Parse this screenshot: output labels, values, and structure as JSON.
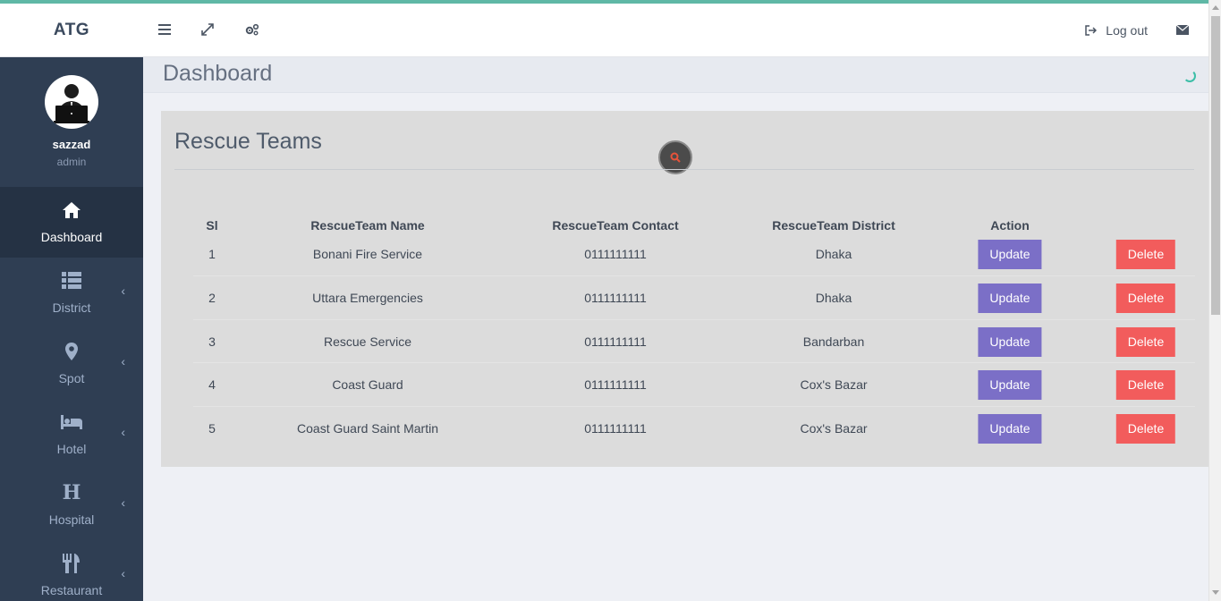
{
  "brand": "ATG",
  "topbar": {
    "logout_label": "Log out"
  },
  "user": {
    "name": "sazzad",
    "role": "admin"
  },
  "sidebar": {
    "items": [
      {
        "label": "Dashboard",
        "icon": "home-icon",
        "active": true
      },
      {
        "label": "District",
        "icon": "list-icon"
      },
      {
        "label": "Spot",
        "icon": "map-marker-icon"
      },
      {
        "label": "Hotel",
        "icon": "bed-icon"
      },
      {
        "label": "Hospital",
        "icon": "hospital-h-icon"
      },
      {
        "label": "Restaurant",
        "icon": "cutlery-icon"
      }
    ]
  },
  "header": {
    "title": "Dashboard"
  },
  "panel": {
    "title": "Rescue Teams",
    "columns": [
      "Sl",
      "RescueTeam Name",
      "RescueTeam Contact",
      "RescueTeam District",
      "Action"
    ],
    "update_label": "Update",
    "delete_label": "Delete",
    "rows": [
      {
        "sl": "1",
        "name": "Bonani Fire Service",
        "contact": "0111111111",
        "district": "Dhaka"
      },
      {
        "sl": "2",
        "name": "Uttara Emergencies",
        "contact": "0111111111",
        "district": "Dhaka"
      },
      {
        "sl": "3",
        "name": "Rescue Service",
        "contact": "0111111111",
        "district": "Bandarban"
      },
      {
        "sl": "4",
        "name": "Coast Guard",
        "contact": "0111111111",
        "district": "Cox's Bazar"
      },
      {
        "sl": "5",
        "name": "Coast Guard Saint Martin",
        "contact": "0111111111",
        "district": "Cox's Bazar"
      }
    ]
  },
  "colors": {
    "sidebar_bg": "#2f3e53",
    "accent": "#5fb8a6",
    "update_button": "#7b6fc7",
    "delete_button": "#f25c5c"
  }
}
